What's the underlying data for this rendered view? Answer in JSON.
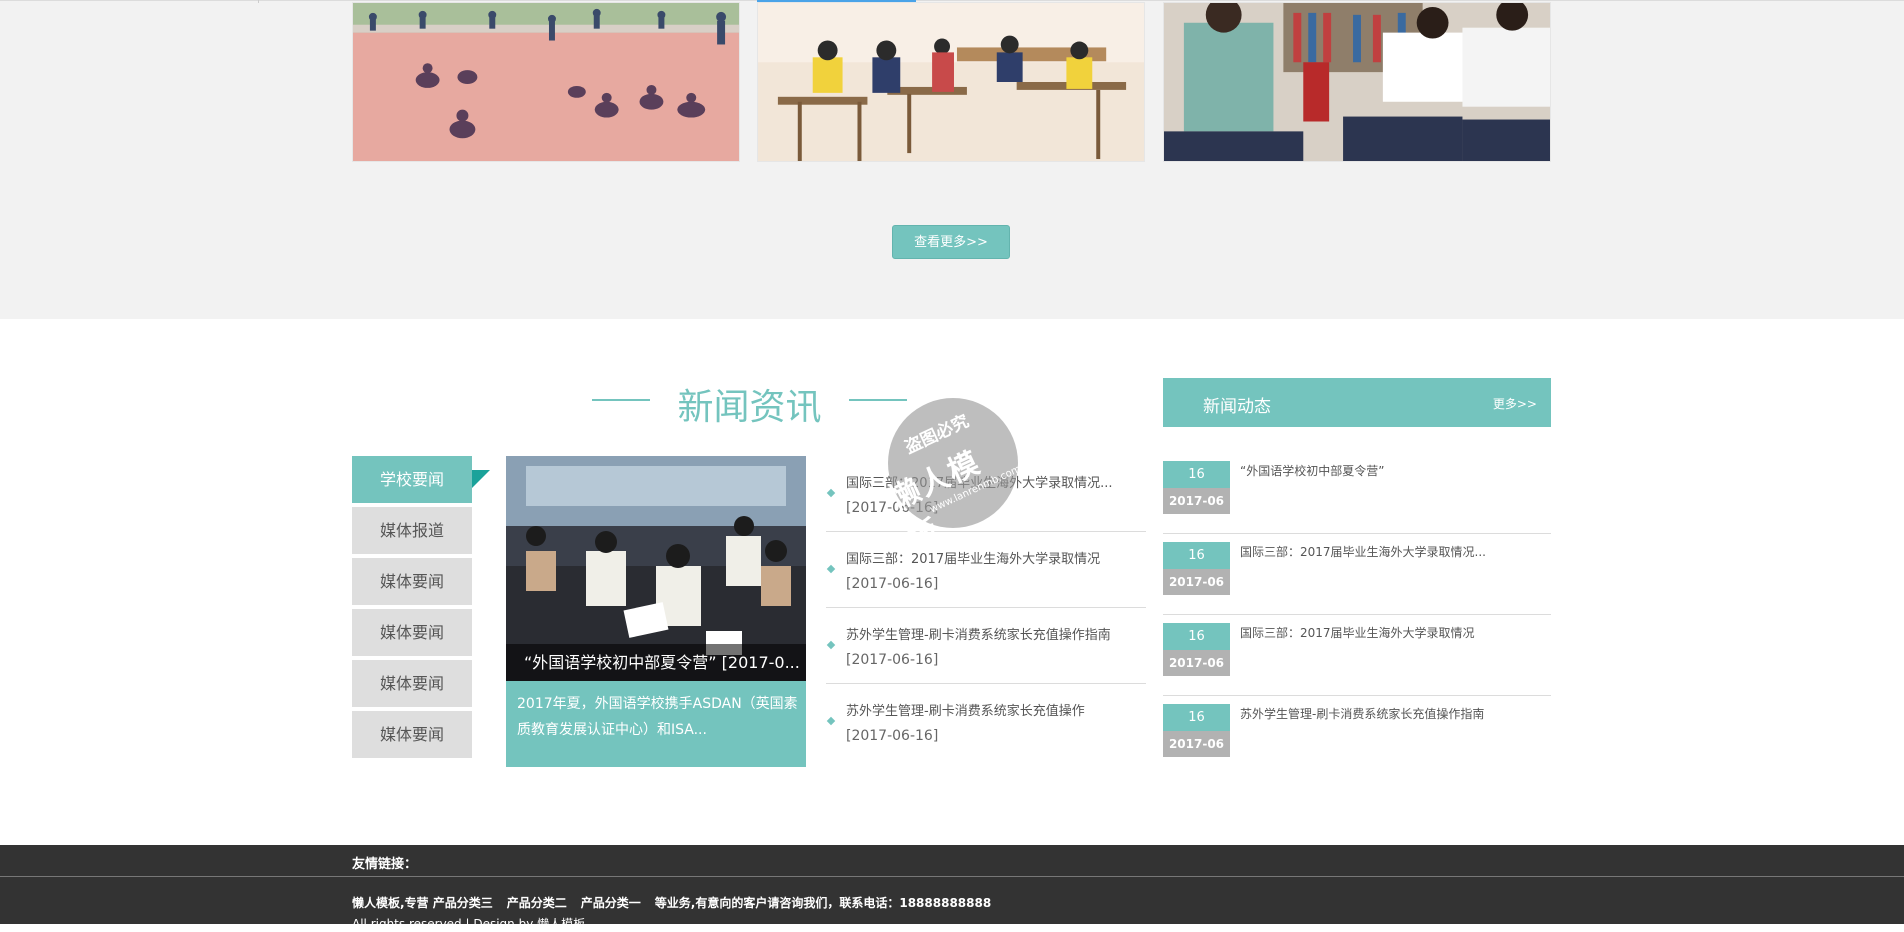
{
  "gallery": {
    "more_button": "查看更多>>"
  },
  "news_section": {
    "title": "新闻资讯",
    "tabs": [
      {
        "label": "学校要闻"
      },
      {
        "label": "媒体报道"
      },
      {
        "label": "媒体要闻"
      },
      {
        "label": "媒体要闻"
      },
      {
        "label": "媒体要闻"
      },
      {
        "label": "媒体要闻"
      }
    ],
    "feature": {
      "caption": "“外国语学校初中部夏令营” [2017-0...",
      "description": "2017年夏，外国语学校携手ASDAN（英国素质教育发展认证中心）和ISA..."
    },
    "items": [
      {
        "title": "国际三部：2017届毕业生海外大学录取情况...",
        "date": "[2017-06-16]"
      },
      {
        "title": "国际三部：2017届毕业生海外大学录取情况",
        "date": "[2017-06-16]"
      },
      {
        "title": "苏外学生管理-刷卡消费系统家长充值操作指南",
        "date": "[2017-06-16]"
      },
      {
        "title": "苏外学生管理-刷卡消费系统家长充值操作",
        "date": "[2017-06-16]"
      }
    ]
  },
  "dynamics": {
    "title": "新闻动态",
    "more": "更多>>",
    "items": [
      {
        "day": "16",
        "month": "2017-06",
        "title": "“外国语学校初中部夏令营”"
      },
      {
        "day": "16",
        "month": "2017-06",
        "title": "国际三部：2017届毕业生海外大学录取情况..."
      },
      {
        "day": "16",
        "month": "2017-06",
        "title": "国际三部：2017届毕业生海外大学录取情况"
      },
      {
        "day": "16",
        "month": "2017-06",
        "title": "苏外学生管理-刷卡消费系统家长充值操作指南"
      }
    ]
  },
  "watermark": {
    "line1": "盗图必究",
    "line2": "懒人模板",
    "line3": "www.lanrenmb.com"
  },
  "footer": {
    "links_label": "友情链接：",
    "nav": [
      "懒人模板,专营 产品分类三",
      "产品分类二",
      "产品分类一",
      "等业务,有意向的客户请咨询我们，联系电话：18888888888"
    ],
    "copyright": "All rights reserved | Design by 懒人模板"
  },
  "colors": {
    "accent": "#74c4be",
    "gray_band": "#f2f2f2",
    "footer": "#333333"
  }
}
